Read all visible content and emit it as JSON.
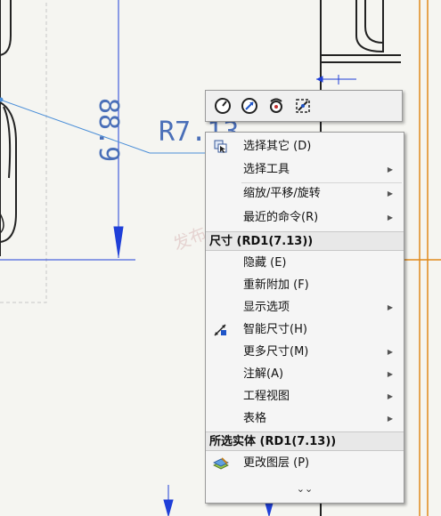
{
  "drawing": {
    "dimension_vertical": "88.9",
    "dimension_radius": "R7.13"
  },
  "toolbar": {
    "buttons": [
      {
        "icon": "gauge-icon"
      },
      {
        "icon": "zoom-fit-icon"
      },
      {
        "icon": "rotate-view-icon"
      },
      {
        "icon": "select-filter-icon"
      }
    ]
  },
  "menu": {
    "items_top": [
      {
        "label": "选择其它 (D)",
        "icon": "select-other-icon",
        "submenu": false
      },
      {
        "label": "选择工具",
        "submenu": true
      },
      {
        "label": "缩放/平移/旋转",
        "submenu": true
      },
      {
        "label": "最近的命令(R)",
        "submenu": true
      }
    ],
    "section1_header": "尺寸 (RD1(7.13))",
    "items_dim": [
      {
        "label": "隐藏 (E)",
        "submenu": false
      },
      {
        "label": "重新附加 (F)",
        "submenu": false
      },
      {
        "label": "显示选项",
        "submenu": true
      },
      {
        "label": "智能尺寸(H)",
        "icon": "smart-dimension-icon",
        "submenu": false
      },
      {
        "label": "更多尺寸(M)",
        "submenu": true
      },
      {
        "label": "注解(A)",
        "submenu": true
      },
      {
        "label": "工程视图",
        "submenu": true
      },
      {
        "label": "表格",
        "submenu": true
      }
    ],
    "section2_header": "所选实体 (RD1(7.13))",
    "items_entity": [
      {
        "label": "更改图层 (P)",
        "icon": "layer-icon",
        "submenu": false
      }
    ],
    "more_glyph": "⌄⌄"
  },
  "watermark": "发布于 gongkong"
}
